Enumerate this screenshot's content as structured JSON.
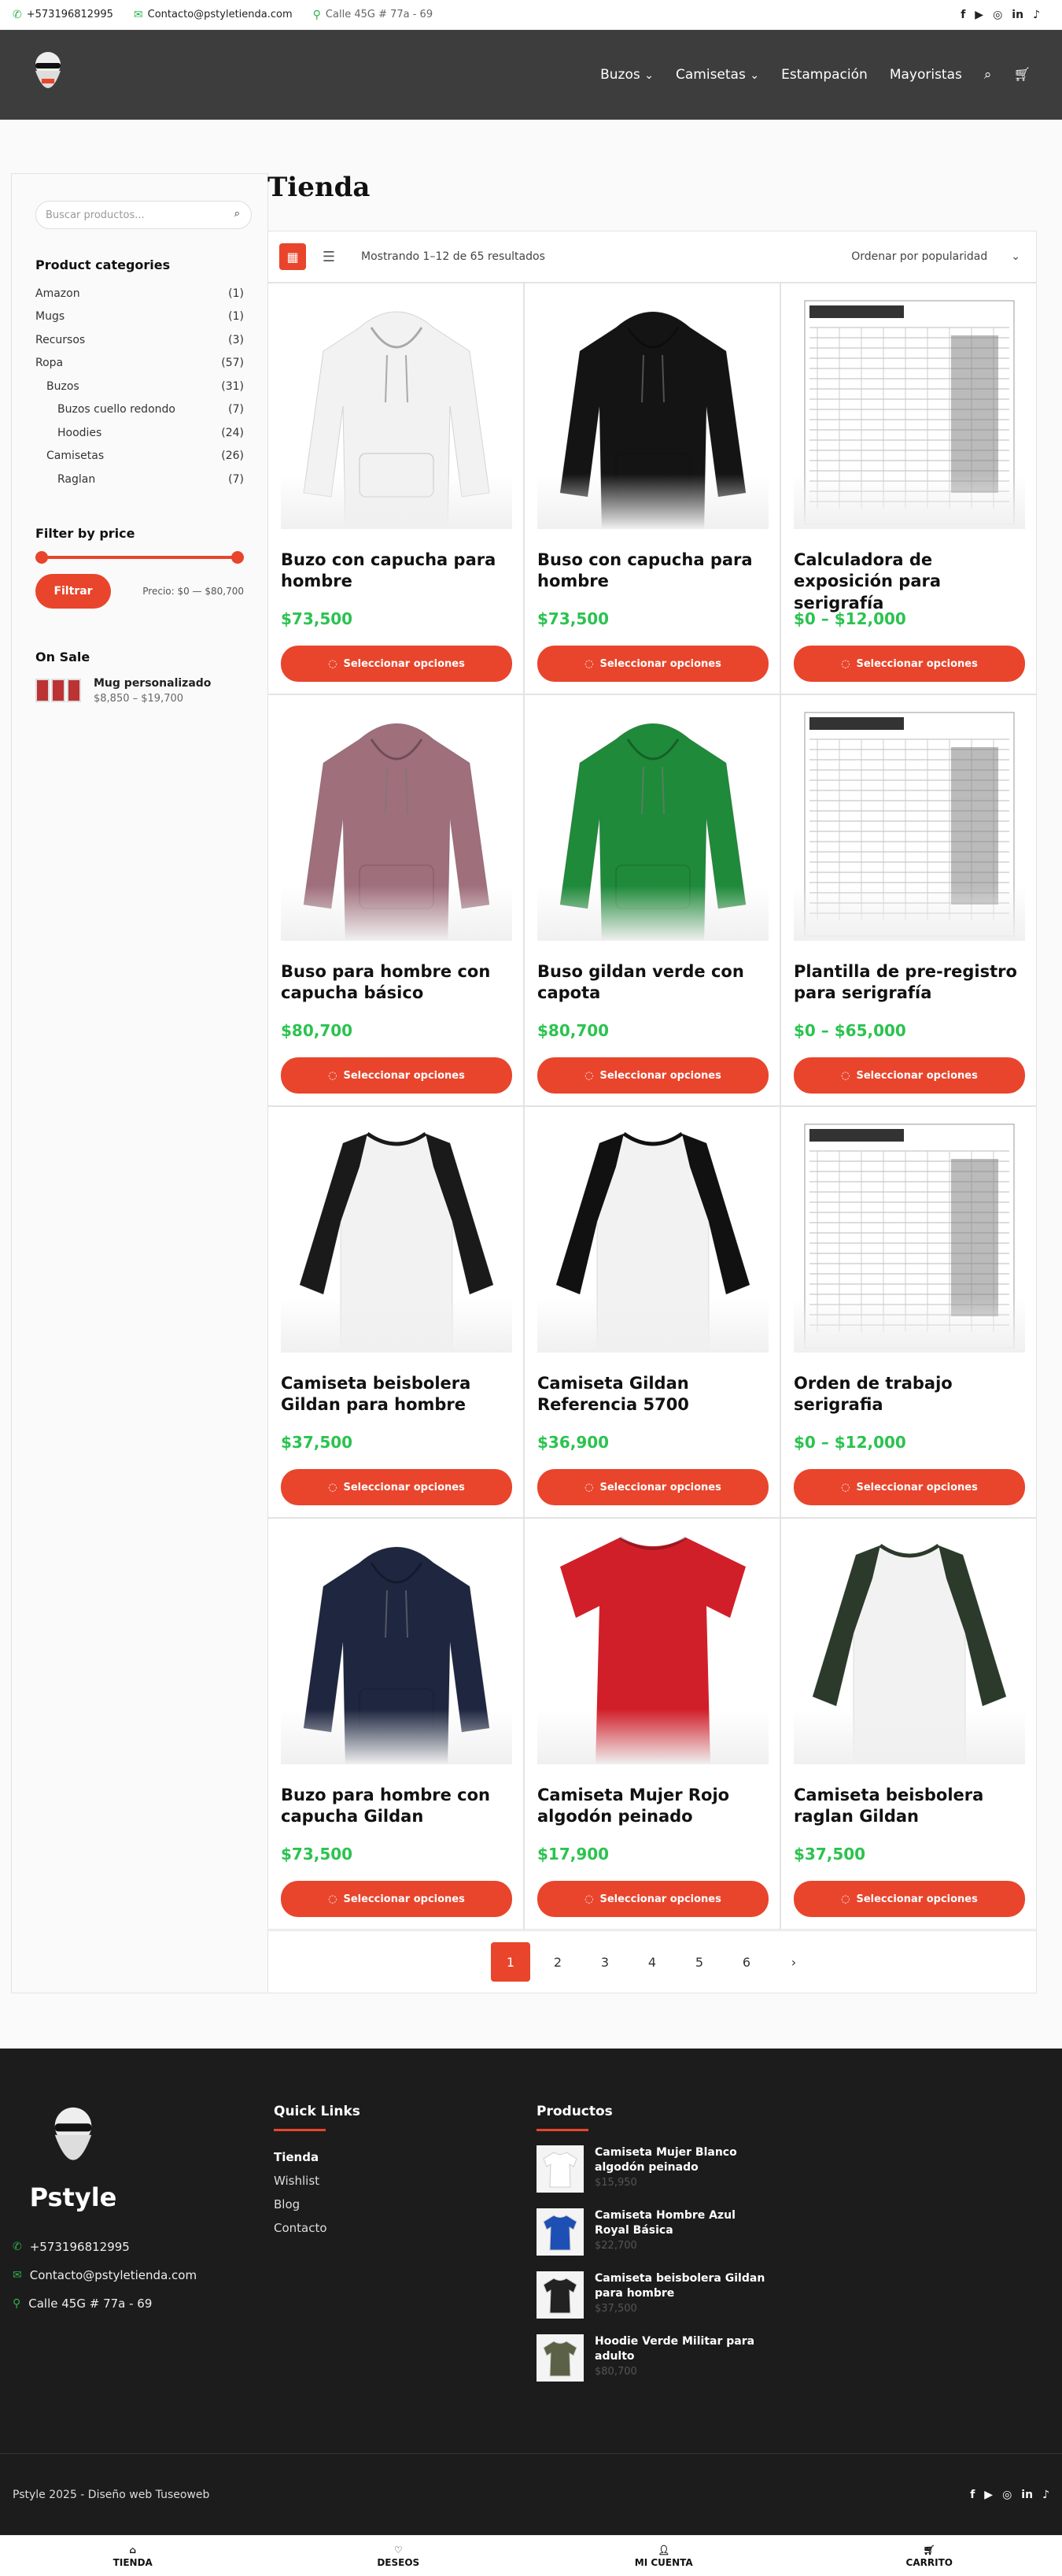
{
  "topbar": {
    "phone": "+573196812995",
    "email": "Contacto@pstyletienda.com",
    "address": "Calle 45G # 77a - 69",
    "socials": [
      "f",
      "▶",
      "◎",
      "in",
      "♪"
    ]
  },
  "nav": {
    "items": [
      "Buzos",
      "Camisetas",
      "Estampación",
      "Mayoristas"
    ]
  },
  "sidebar": {
    "search_placeholder": "Buscar productos...",
    "categories_title": "Product categories",
    "categories": [
      {
        "name": "Amazon",
        "count": "(1)"
      },
      {
        "name": "Mugs",
        "count": "(1)"
      },
      {
        "name": "Recursos",
        "count": "(3)"
      },
      {
        "name": "Ropa",
        "count": "(57)"
      },
      {
        "name": "Buzos",
        "count": "(31)"
      },
      {
        "name": "Buzos cuello redondo",
        "count": "(7)"
      },
      {
        "name": "Hoodies",
        "count": "(24)"
      },
      {
        "name": "Camisetas",
        "count": "(26)"
      },
      {
        "name": "Raglan",
        "count": "(7)"
      }
    ],
    "filter_title": "Filter by price",
    "filter_button": "Filtrar",
    "price_range": "Precio: $0 — $80,700",
    "onsale_title": "On Sale",
    "onsale_name": "Mug personalizado",
    "onsale_price": "$8,850 – $19,700"
  },
  "shop": {
    "title": "Tienda",
    "result_count": "Mostrando 1–12 de 65 resultados",
    "orderby": "Ordenar por popularidad"
  },
  "products": [
    {
      "name": "Buzo con capucha para hombre",
      "price": "$73,500",
      "img": "hoodie",
      "color": "#f2f2f2"
    },
    {
      "name": "Buso con capucha para hombre",
      "price": "$73,500",
      "img": "hoodie",
      "color": "#141414"
    },
    {
      "name": "Calculadora de exposición para serigrafía",
      "price": "$0 – $12,000",
      "img": "sheet",
      "color": "#ffffff"
    },
    {
      "name": "Buso para hombre con capucha básico",
      "price": "$80,700",
      "img": "hoodie",
      "color": "#a06f7c"
    },
    {
      "name": "Buso gildan verde con capota",
      "price": "$80,700",
      "img": "hoodie",
      "color": "#1f8a3a"
    },
    {
      "name": "Plantilla de pre-registro para serigrafía",
      "price": "$0 – $65,000",
      "img": "sheet",
      "color": "#ffffff"
    },
    {
      "name": "Camiseta beisbolera Gildan para hombre",
      "price": "$37,500",
      "img": "raglan",
      "color": "#1a1a1a"
    },
    {
      "name": "Camiseta Gildan Referencia 5700",
      "price": "$36,900",
      "img": "raglan",
      "color": "#111111"
    },
    {
      "name": "Orden de trabajo serigrafia",
      "price": "$0 – $12,000",
      "img": "sheet",
      "color": "#ffffff"
    },
    {
      "name": "Buzo para hombre con capucha Gildan",
      "price": "$73,500",
      "img": "hoodie",
      "color": "#1e2640"
    },
    {
      "name": "Camiseta Mujer Rojo algodón peinado",
      "price": "$17,900",
      "img": "tee",
      "color": "#d11f2a"
    },
    {
      "name": "Camiseta beisbolera raglan Gildan",
      "price": "$37,500",
      "img": "raglan",
      "color": "#2b3a2a"
    }
  ],
  "buttons": {
    "select_options": "Seleccionar opciones"
  },
  "pagination": [
    "1",
    "2",
    "3",
    "4",
    "5",
    "6",
    "›"
  ],
  "footer": {
    "brand": "Pstyle",
    "phone": "+573196812995",
    "email": "Contacto@pstyletienda.com",
    "address": "Calle 45G # 77a - 69",
    "quicklinks_title": "Quick Links",
    "quicklinks": [
      "Tienda",
      "Wishlist",
      "Blog",
      "Contacto"
    ],
    "products_title": "Productos",
    "products": [
      {
        "name": "Camiseta Mujer Blanco algodón peinado",
        "price": "$15,950",
        "color": "#ffffff"
      },
      {
        "name": "Camiseta Hombre Azul Royal Básica",
        "price": "$22,700",
        "color": "#1d4fb5"
      },
      {
        "name": "Camiseta beisbolera Gildan para hombre",
        "price": "$37,500",
        "color": "#222222"
      },
      {
        "name": "Hoodie Verde Militar para adulto",
        "price": "$80,700",
        "color": "#5b6147"
      }
    ],
    "copyright": "Pstyle 2025 - Diseño web Tuseoweb"
  },
  "bottom_nav": [
    {
      "label": "TIENDA",
      "icon": "store-icon"
    },
    {
      "label": "DESEOS",
      "icon": "wishlist-icon"
    },
    {
      "label": "MI CUENTA",
      "icon": "account-icon"
    },
    {
      "label": "CARRITO",
      "icon": "cart-icon"
    }
  ]
}
